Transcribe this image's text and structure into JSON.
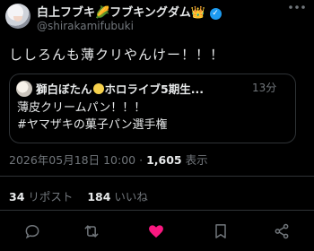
{
  "author": {
    "name": "白上フブキ",
    "name_suffix": "フブキングダム",
    "corn_emoji": "🌽",
    "crown_emoji": "👑",
    "verified_glyph": "✓",
    "handle": "@shirakamifubuki"
  },
  "tweet": {
    "text": "ししろんも薄クリやんけー！！！"
  },
  "quote": {
    "name_prefix": "獅白ぼたん",
    "name_suffix": "ホロライブ5期生...",
    "time": "13分",
    "body": "薄皮クリームパン！！！\n#ヤマザキの菓子パン選手権"
  },
  "meta": {
    "datetime": "2026年05月18日 10:00",
    "separator": "·",
    "views_count": "1,605",
    "views_label": "表示"
  },
  "stats": {
    "reposts_count": "34",
    "reposts_label": "リポスト",
    "likes_count": "184",
    "likes_label": "いいね"
  },
  "colors": {
    "background": "#000000",
    "text": "#e7e9ea",
    "muted": "#71767b",
    "border": "#2f3336",
    "like": "#f91880",
    "verified": "#1d9bf0"
  }
}
